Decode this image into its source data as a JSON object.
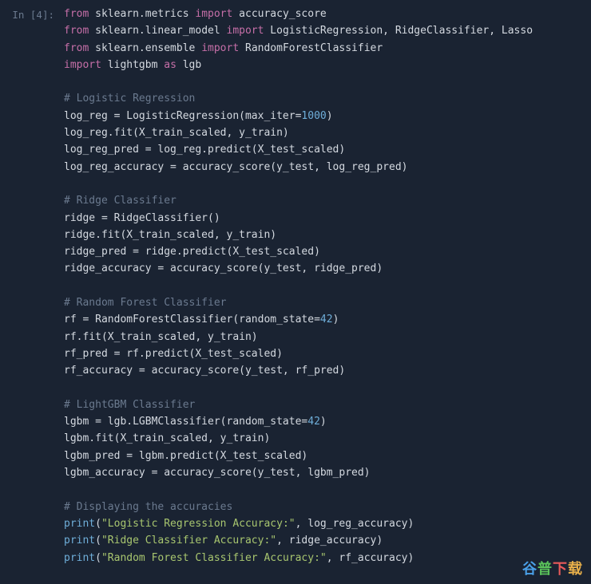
{
  "prompt": "In [4]:",
  "code": {
    "l1": {
      "kw1": "from",
      "m1": " sklearn.metrics ",
      "kw2": "import",
      "m2": " accuracy_score"
    },
    "l2": {
      "kw1": "from",
      "m1": " sklearn.linear_model ",
      "kw2": "import",
      "m2": " LogisticRegression, RidgeClassifier, Lasso"
    },
    "l3": {
      "kw1": "from",
      "m1": " sklearn.ensemble ",
      "kw2": "import",
      "m2": " RandomForestClassifier"
    },
    "l4": {
      "kw1": "import",
      "m1": " lightgbm ",
      "kw2": "as",
      "m2": " lgb"
    },
    "l6": "# Logistic Regression",
    "l7": {
      "a": "log_reg = LogisticRegression(max_iter=",
      "n": "1000",
      "b": ")"
    },
    "l8": "log_reg.fit(X_train_scaled, y_train)",
    "l9": "log_reg_pred = log_reg.predict(X_test_scaled)",
    "l10": "log_reg_accuracy = accuracy_score(y_test, log_reg_pred)",
    "l12": "# Ridge Classifier",
    "l13": "ridge = RidgeClassifier()",
    "l14": "ridge.fit(X_train_scaled, y_train)",
    "l15": "ridge_pred = ridge.predict(X_test_scaled)",
    "l16": "ridge_accuracy = accuracy_score(y_test, ridge_pred)",
    "l18": "# Random Forest Classifier",
    "l19": {
      "a": "rf = RandomForestClassifier(random_state=",
      "n": "42",
      "b": ")"
    },
    "l20": "rf.fit(X_train_scaled, y_train)",
    "l21": "rf_pred = rf.predict(X_test_scaled)",
    "l22": "rf_accuracy = accuracy_score(y_test, rf_pred)",
    "l24": "# LightGBM Classifier",
    "l25": {
      "a": "lgbm = lgb.LGBMClassifier(random_state=",
      "n": "42",
      "b": ")"
    },
    "l26": "lgbm.fit(X_train_scaled, y_train)",
    "l27": "lgbm_pred = lgbm.predict(X_test_scaled)",
    "l28": "lgbm_accuracy = accuracy_score(y_test, lgbm_pred)",
    "l30": "# Displaying the accuracies",
    "l31": {
      "p": "print",
      "a": "(",
      "s": "\"Logistic Regression Accuracy:\"",
      "b": ", log_reg_accuracy)"
    },
    "l32": {
      "p": "print",
      "a": "(",
      "s": "\"Ridge Classifier Accuracy:\"",
      "b": ", ridge_accuracy)"
    },
    "l33": {
      "p": "print",
      "a": "(",
      "s": "\"Random Forest Classifier Accuracy:\"",
      "b": ", rf_accuracy)"
    }
  },
  "watermark": {
    "c1": "谷",
    "c2": "普",
    "c3": "下",
    "c4": "载"
  }
}
